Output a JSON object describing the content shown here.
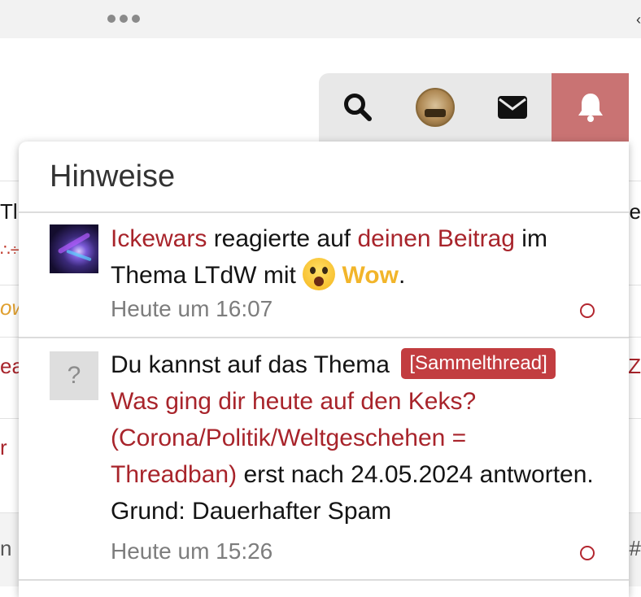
{
  "browser": {
    "menu_icon": "ellipsis-icon"
  },
  "background_page": {
    "fragments": [
      {
        "left": "Tl",
        "right": "e",
        "left_color": "#141414",
        "right_color": "#141414"
      },
      {
        "left": "∴÷",
        "right": "",
        "left_color": "#c0392b",
        "right_color": "#141414"
      },
      {
        "left": "ow",
        "right": "",
        "left_color": "#e0a030",
        "right_color": "#141414"
      },
      {
        "left": "ea",
        "right": "Z",
        "left_color": "#a8242b",
        "right_color": "#a8242b"
      },
      {
        "left": "r",
        "right": "",
        "left_color": "#a8242b",
        "right_color": "#141414"
      },
      {
        "left": "n",
        "right": "#",
        "left_color": "#555555",
        "right_color": "#555555"
      }
    ]
  },
  "navbar": {
    "search_icon": "search-icon",
    "avatar_icon": "user-avatar",
    "mail_icon": "envelope-icon",
    "alerts_icon": "bell-icon",
    "alerts_active_color": "#c97373"
  },
  "popup": {
    "title": "Hinweise",
    "alerts": [
      {
        "user": "Ickewars",
        "text_1": " reagierte auf ",
        "link": "deinen Beitrag",
        "text_2": " im Thema LTdW mit ",
        "reaction_icon": "astonished-emoji",
        "reaction": "Wow",
        "text_3": ".",
        "time": "Heute um 16:07",
        "unread": true
      },
      {
        "avatar_placeholder": "?",
        "text_1": "Du kannst auf das Thema ",
        "prefix_badge": "[Sammelthread]",
        "thread_link": "Was ging dir heute auf den Keks? (Corona/Politik/Weltgeschehen = Threadban)",
        "text_2": " erst nach 24.05.2024 antworten. Grund: Dauerhafter Spam",
        "time": "Heute um 15:26",
        "unread": true
      }
    ]
  },
  "colors": {
    "link_red": "#a8242b",
    "badge_red": "#c23d40",
    "wow_yellow": "#f2b52a"
  }
}
